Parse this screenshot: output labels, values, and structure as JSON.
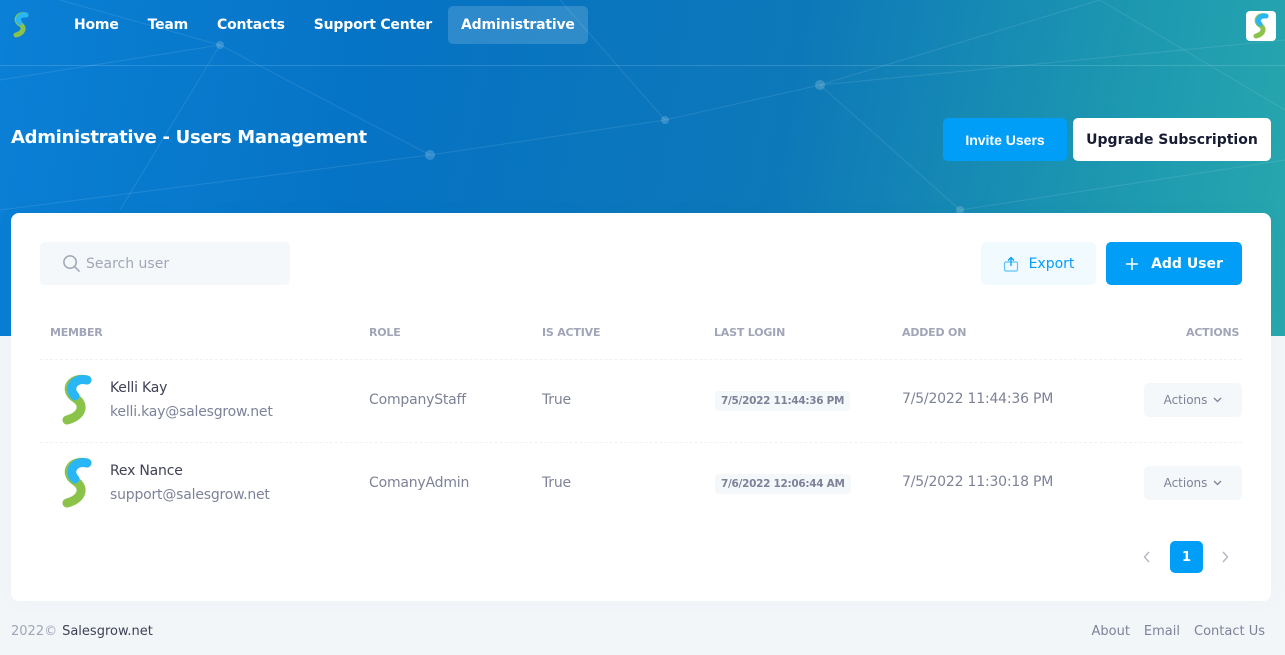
{
  "nav": {
    "items": [
      {
        "label": "Home"
      },
      {
        "label": "Team"
      },
      {
        "label": "Contacts"
      },
      {
        "label": "Support Center"
      },
      {
        "label": "Administrative",
        "active": true
      }
    ]
  },
  "header": {
    "title": "Administrative - Users Management",
    "invite_label": "Invite Users",
    "upgrade_label": "Upgrade Subscription"
  },
  "toolbar": {
    "search_placeholder": "Search user",
    "export_label": "Export",
    "add_label": "Add User"
  },
  "table": {
    "columns": {
      "member": "MEMBER",
      "role": "ROLE",
      "is_active": "IS ACTIVE",
      "last_login": "LAST LOGIN",
      "added_on": "ADDED ON",
      "actions": "ACTIONS"
    },
    "rows": [
      {
        "name": "Kelli Kay",
        "email": "kelli.kay@salesgrow.net",
        "role": "CompanyStaff",
        "is_active": "True",
        "last_login": "7/5/2022 11:44:36 PM",
        "added_on": "7/5/2022 11:44:36 PM",
        "actions_label": "Actions"
      },
      {
        "name": "Rex Nance",
        "email": "support@salesgrow.net",
        "role": "ComanyAdmin",
        "is_active": "True",
        "last_login": "7/6/2022 12:06:44 AM",
        "added_on": "7/5/2022 11:30:18 PM",
        "actions_label": "Actions"
      }
    ]
  },
  "pagination": {
    "current_page": "1",
    "prev_icon": "chevron-left-icon",
    "next_icon": "chevron-right-icon"
  },
  "footer": {
    "year": "2022©",
    "brand": "Salesgrow.net",
    "links": [
      "About",
      "Email",
      "Contact Us"
    ]
  },
  "colors": {
    "primary": "#009ef7",
    "header_gradient_start": "#0a80d6",
    "header_gradient_end": "#28a8ae",
    "logo_blue": "#1e88e5",
    "logo_green": "#8bc34a"
  }
}
